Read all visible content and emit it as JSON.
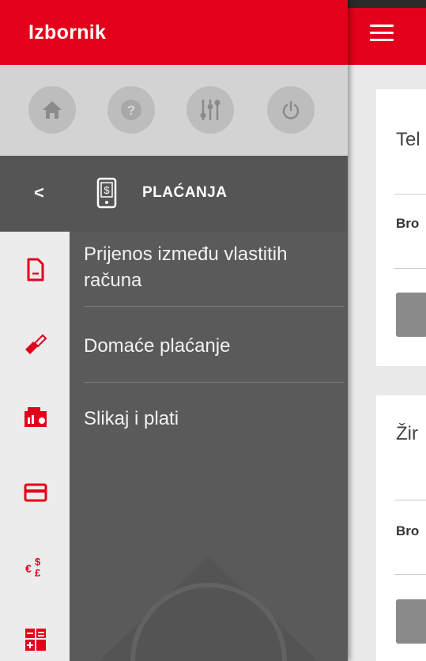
{
  "drawer": {
    "title": "Izbornik",
    "quick_actions": [
      {
        "icon": "home-icon"
      },
      {
        "icon": "help-icon",
        "glyph": "?"
      },
      {
        "icon": "settings-sliders-icon"
      },
      {
        "icon": "power-icon"
      }
    ],
    "section": {
      "back": "<",
      "title": "PLAĆANJA",
      "icon": "mobile-payment-icon"
    },
    "rail_icons": [
      "document-icon",
      "transfer-icon",
      "camera-bill-icon",
      "card-icon",
      "currency-exchange-icon",
      "calculator-icon"
    ],
    "menu_items": [
      {
        "label": "Prijenos između vlastitih računa"
      },
      {
        "label": "Domaće plaćanje"
      },
      {
        "label": "Slikaj i plati"
      }
    ]
  },
  "page": {
    "cards": [
      {
        "title": "Tel",
        "label": "Bro"
      },
      {
        "title": "Žir",
        "label": "Bro"
      }
    ]
  },
  "colors": {
    "brand_red": "#e2001a",
    "drawer_gray": "#5a5a5a",
    "rail_gray": "#ececec",
    "rail_icon_red": "#e2001a"
  }
}
